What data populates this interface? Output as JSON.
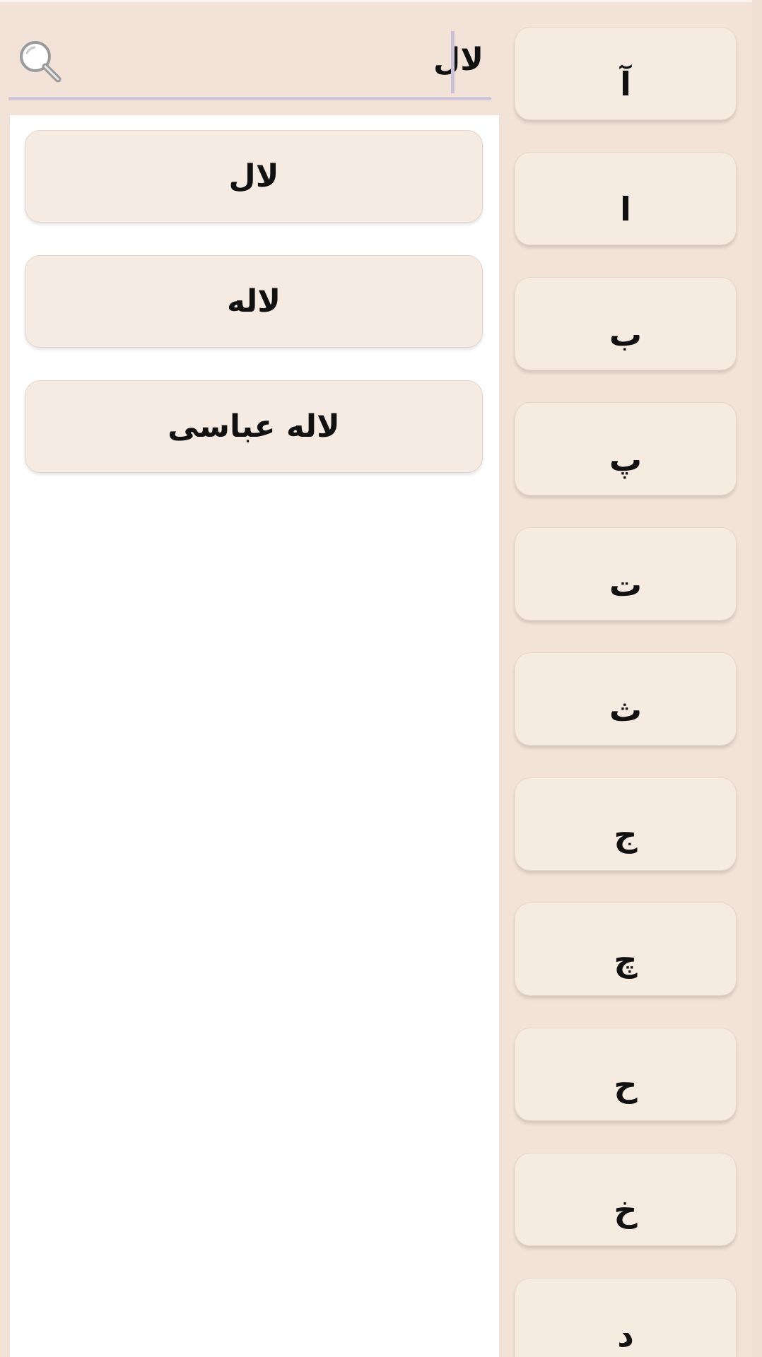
{
  "search": {
    "value": "لال",
    "icon": "search-icon"
  },
  "results": [
    {
      "label": "لال"
    },
    {
      "label": "لاله"
    },
    {
      "label": "لاله عباسی"
    }
  ],
  "letters": [
    {
      "label": "آ"
    },
    {
      "label": "ا"
    },
    {
      "label": "ب"
    },
    {
      "label": "پ"
    },
    {
      "label": "ت"
    },
    {
      "label": "ث"
    },
    {
      "label": "ج"
    },
    {
      "label": "چ"
    },
    {
      "label": "ح"
    },
    {
      "label": "خ"
    },
    {
      "label": "د"
    }
  ],
  "colors": {
    "background": "#f2e2d7",
    "card": "#f6ebe1",
    "panel": "#ffffff",
    "underline": "#cfc7d5"
  }
}
